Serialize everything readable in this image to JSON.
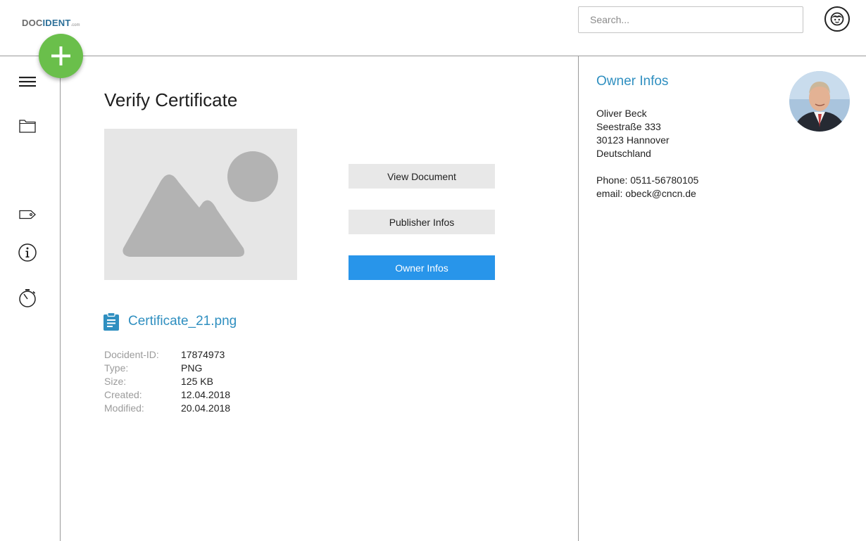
{
  "header": {
    "logo": {
      "prefix": "DOC",
      "brand": "IDENT",
      "suffix": ".com"
    },
    "search": {
      "placeholder": "Search...",
      "value": ""
    },
    "user_icon": "user-face-icon"
  },
  "fab": {
    "icon": "plus-icon",
    "color": "#6abf4b"
  },
  "sidebar": {
    "items": [
      {
        "icon": "menu-icon"
      },
      {
        "icon": "folder-icon"
      },
      {
        "icon": "tag-icon"
      },
      {
        "icon": "info-icon"
      },
      {
        "icon": "timer-icon"
      }
    ]
  },
  "main": {
    "title": "Verify Certificate",
    "preview_icon": "image-placeholder-icon",
    "actions": [
      {
        "label": "View Document"
      },
      {
        "label": "Publisher Infos"
      },
      {
        "label": "Owner Infos",
        "active": true
      }
    ],
    "file": {
      "icon": "clipboard-icon",
      "name": "Certificate_21.png",
      "meta": [
        {
          "label": "Docident-ID:",
          "value": "17874973"
        },
        {
          "label": "Type:",
          "value": "PNG"
        },
        {
          "label": "Size:",
          "value": "125 KB"
        },
        {
          "label": "Created:",
          "value": "12.04.2018"
        },
        {
          "label": "Modified:",
          "value": "20.04.2018"
        }
      ]
    }
  },
  "owner_panel": {
    "title": "Owner Infos",
    "name": "Oliver Beck",
    "street": "Seestraße 333",
    "city": "30123 Hannover",
    "country": "Deutschland",
    "phone": "Phone: 0511-56780105",
    "email": "email: obeck@cncn.de"
  },
  "colors": {
    "accent": "#2f8fc0",
    "primary_button": "#2895ea",
    "fab": "#6abf4b",
    "button_bg": "#e8e8e8"
  }
}
